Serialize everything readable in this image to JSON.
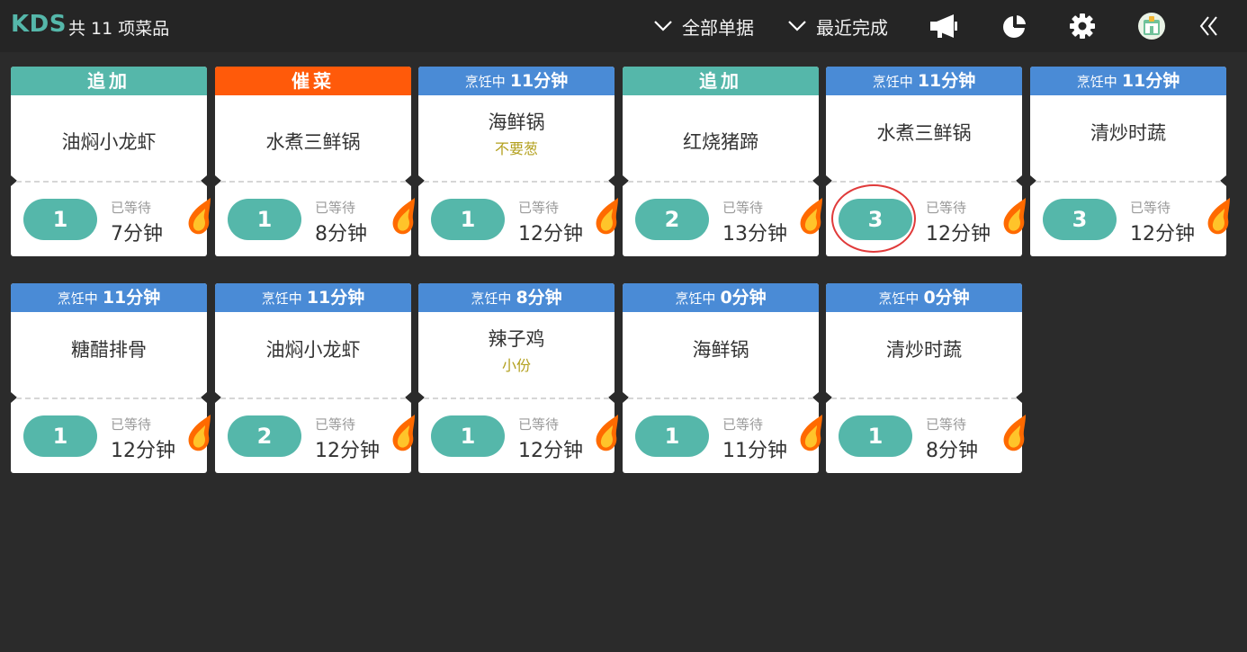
{
  "header": {
    "brand": "KDS",
    "count_text": "共 11 项菜品",
    "filter_all": "全部单据",
    "filter_recent": "最近完成",
    "icons": [
      "megaphone-icon",
      "pie-chart-icon",
      "gear-icon",
      "avatar-icon",
      "double-chevron-left-icon"
    ]
  },
  "colors": {
    "accent": "#55b7aa",
    "urgent": "#ff5a0a",
    "cooking": "#4a8bd6",
    "background": "#2b2b2b",
    "note": "#b3a01e",
    "highlight_circle": "#e03a3a"
  },
  "wait_label": "已等待",
  "cooking_prefix": "烹饪中",
  "cards": [
    {
      "status": "add",
      "status_label": "追加",
      "dish": "油焖小龙虾",
      "note": "",
      "qty": "1",
      "wait": "7分钟"
    },
    {
      "status": "urge",
      "status_label": "催菜",
      "dish": "水煮三鲜锅",
      "note": "",
      "qty": "1",
      "wait": "8分钟"
    },
    {
      "status": "cooking",
      "status_label": "11分钟",
      "dish": "海鲜锅",
      "note": "不要葱",
      "qty": "1",
      "wait": "12分钟"
    },
    {
      "status": "add",
      "status_label": "追加",
      "dish": "红烧猪蹄",
      "note": "",
      "qty": "2",
      "wait": "13分钟"
    },
    {
      "status": "cooking",
      "status_label": "11分钟",
      "dish": "水煮三鲜锅",
      "note": "",
      "qty": "3",
      "wait": "12分钟",
      "highlighted": true
    },
    {
      "status": "cooking",
      "status_label": "11分钟",
      "dish": "清炒时蔬",
      "note": "",
      "qty": "3",
      "wait": "12分钟"
    },
    {
      "status": "cooking",
      "status_label": "11分钟",
      "dish": "糖醋排骨",
      "note": "",
      "qty": "1",
      "wait": "12分钟"
    },
    {
      "status": "cooking",
      "status_label": "11分钟",
      "dish": "油焖小龙虾",
      "note": "",
      "qty": "2",
      "wait": "12分钟"
    },
    {
      "status": "cooking",
      "status_label": "8分钟",
      "dish": "辣子鸡",
      "note": "小份",
      "qty": "1",
      "wait": "12分钟"
    },
    {
      "status": "cooking",
      "status_label": "0分钟",
      "dish": "海鲜锅",
      "note": "",
      "qty": "1",
      "wait": "11分钟"
    },
    {
      "status": "cooking",
      "status_label": "0分钟",
      "dish": "清炒时蔬",
      "note": "",
      "qty": "1",
      "wait": "8分钟"
    }
  ]
}
